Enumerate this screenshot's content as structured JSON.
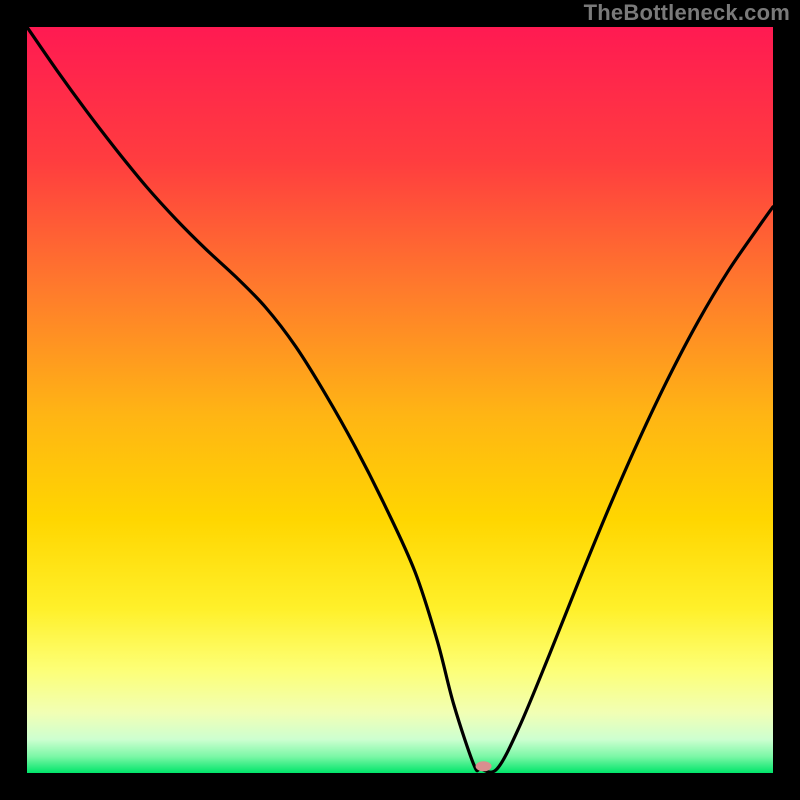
{
  "attribution": "TheBottleneck.com",
  "chart_data": {
    "type": "line",
    "title": "",
    "xlabel": "",
    "ylabel": "",
    "xlim": [
      0,
      100
    ],
    "ylim": [
      0,
      100
    ],
    "gradient_stops": [
      {
        "offset": 0.0,
        "color": "#ff1a52"
      },
      {
        "offset": 0.18,
        "color": "#ff3d3f"
      },
      {
        "offset": 0.35,
        "color": "#ff7a2c"
      },
      {
        "offset": 0.52,
        "color": "#ffb514"
      },
      {
        "offset": 0.66,
        "color": "#ffd600"
      },
      {
        "offset": 0.78,
        "color": "#fff02a"
      },
      {
        "offset": 0.86,
        "color": "#fdff75"
      },
      {
        "offset": 0.92,
        "color": "#f1ffb5"
      },
      {
        "offset": 0.955,
        "color": "#cdffd0"
      },
      {
        "offset": 0.978,
        "color": "#7bf7a6"
      },
      {
        "offset": 1.0,
        "color": "#00e56a"
      }
    ],
    "series": [
      {
        "name": "curve",
        "color": "#000000",
        "x": [
          0,
          4,
          8,
          12,
          16,
          20,
          24,
          28,
          32,
          36,
          40,
          44,
          48,
          52,
          55,
          57.2,
          59.9,
          60.8,
          63,
          66,
          70,
          74,
          78,
          82,
          86,
          90,
          94,
          98,
          100
        ],
        "y": [
          100,
          94.2,
          88.7,
          83.5,
          78.6,
          74.2,
          70.2,
          66.5,
          62.4,
          57.2,
          50.8,
          43.7,
          35.8,
          27.0,
          17.7,
          9.2,
          1.1,
          0.55,
          0.55,
          6.2,
          15.8,
          25.8,
          35.5,
          44.6,
          53.0,
          60.6,
          67.3,
          73.1,
          75.9
        ]
      }
    ],
    "marker": {
      "x": 61.2,
      "y": 0.9,
      "color": "#d98f8f",
      "rx": 8,
      "ry": 5
    }
  }
}
